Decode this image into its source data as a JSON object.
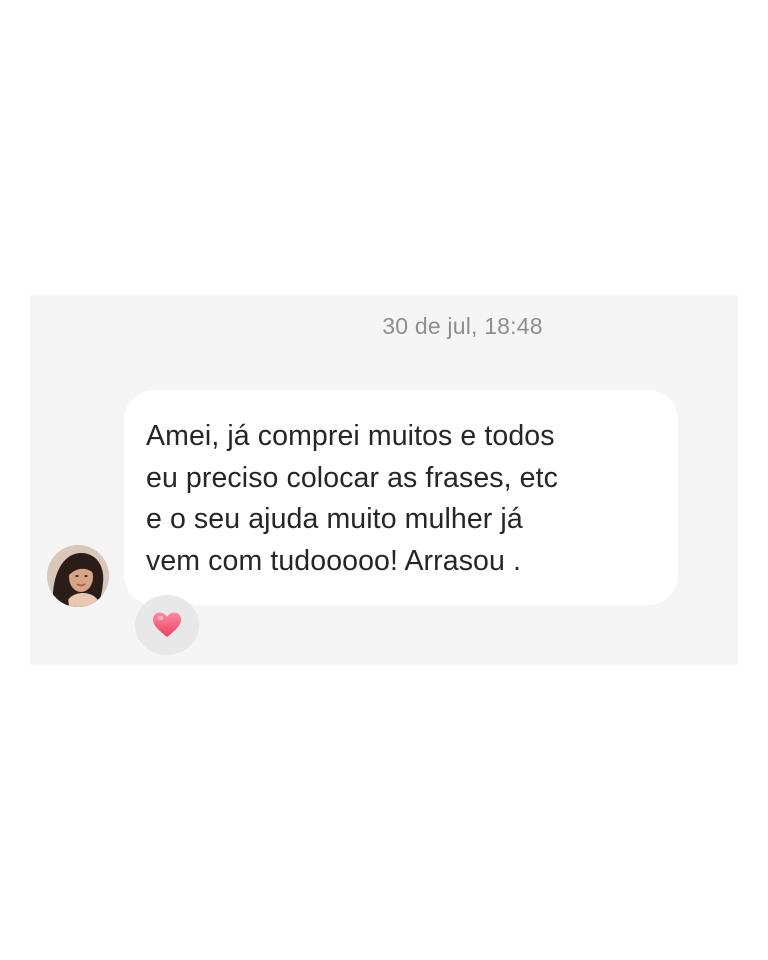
{
  "conversation": {
    "timestamp": "30 de jul, 18:48",
    "message": {
      "lines": [
        "Amei, já comprei muitos e todos",
        "eu preciso colocar as frases, etc",
        "e o seu ajuda muito mulher já",
        "vem com tudooooo! Arrasou ."
      ],
      "sender_avatar": "user-avatar-photo",
      "reaction": {
        "icon": "heart-icon",
        "color": "#f0506e"
      }
    }
  },
  "colors": {
    "panel_background": "#f5f5f5",
    "bubble_background": "#ffffff",
    "text": "#262626",
    "timestamp_text": "#8e8e8e",
    "reaction_background": "#e8e8e8"
  }
}
